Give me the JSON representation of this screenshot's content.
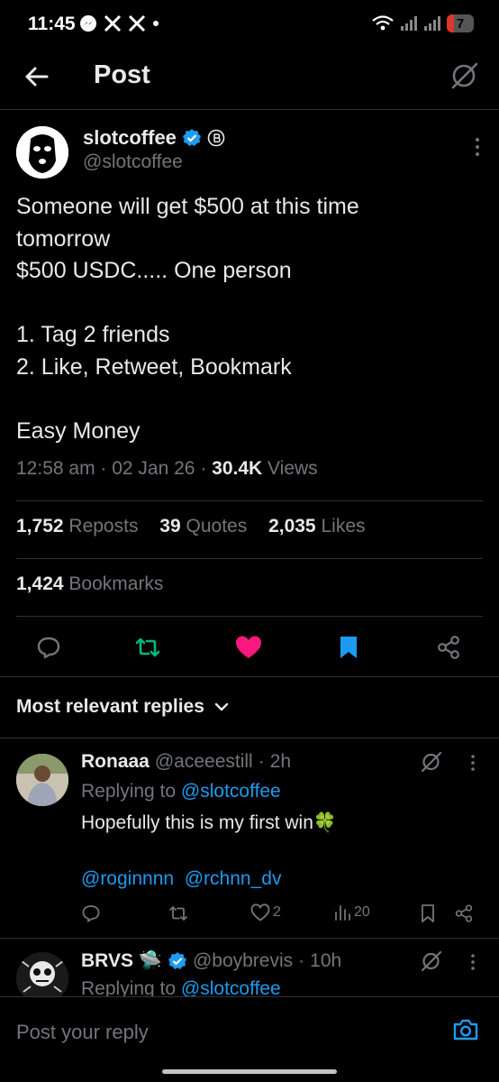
{
  "status_bar": {
    "time": "11:45",
    "battery": "7"
  },
  "header": {
    "title": "Post"
  },
  "post": {
    "name": "slotcoffee",
    "handle": "@slotcoffee",
    "body_lines": [
      "Someone will get $500 at this time",
      "tomorrow",
      "$500 USDC..... One person",
      "",
      "1. Tag 2 friends",
      "2. Like, Retweet, Bookmark",
      "",
      "Easy Money"
    ],
    "time": "12:58 am",
    "date": "02 Jan 26",
    "views": "30.4K",
    "views_label": "Views",
    "reposts": "1,752",
    "reposts_label": "Reposts",
    "quotes": "39",
    "quotes_label": "Quotes",
    "likes": "2,035",
    "likes_label": "Likes",
    "bookmarks": "1,424",
    "bookmarks_label": "Bookmarks"
  },
  "replies_header": "Most relevant replies",
  "replies": [
    {
      "name": "Ronaaa",
      "handle": "@aceeestill",
      "time": "2h",
      "replying_prefix": "Replying to",
      "replying_to": "@slotcoffee",
      "text": "Hopefully this is my first win🍀",
      "mentions": [
        "@roginnnn",
        "@rchnn_dv"
      ],
      "likes": "2",
      "views": "20"
    },
    {
      "name": "BRVS 🛸",
      "handle": "@boybrevis",
      "time": "10h",
      "replying_prefix": "Replying to",
      "replying_to": "@slotcoffee"
    }
  ],
  "composer": {
    "placeholder": "Post your reply"
  },
  "colors": {
    "accent": "#1d9bf0",
    "like": "#f91880",
    "repost": "#00ba7c",
    "muted": "#71767b"
  }
}
